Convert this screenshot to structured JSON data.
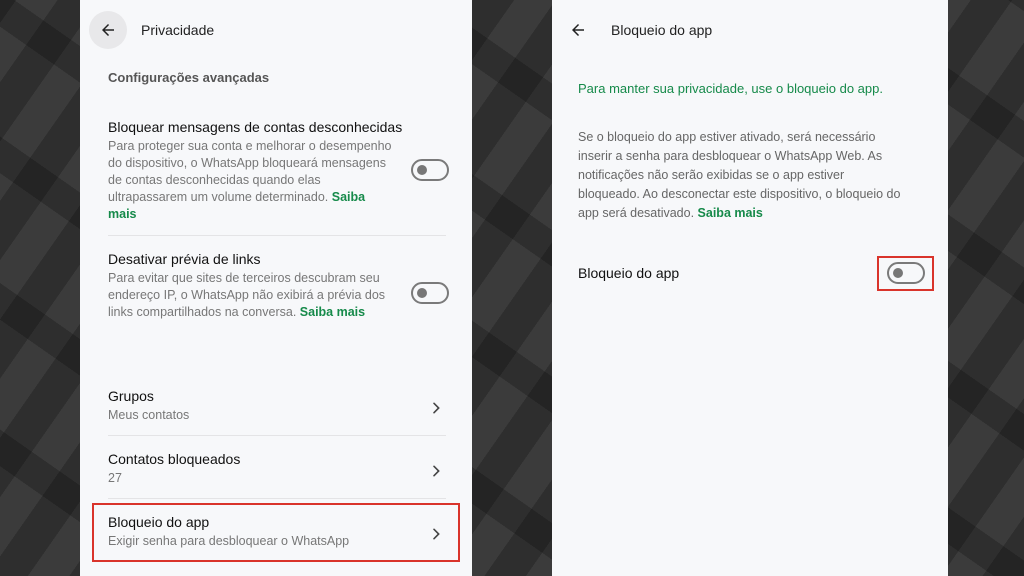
{
  "left": {
    "header_title": "Privacidade",
    "section_title": "Configurações avançadas",
    "block_unknown": {
      "title": "Bloquear mensagens de contas desconhecidas",
      "desc": "Para proteger sua conta e melhorar o desempenho do dispositivo, o WhatsApp bloqueará mensagens de contas desconhecidas quando elas ultrapassarem um volume determinado.",
      "link": "Saiba mais",
      "enabled": false
    },
    "link_preview": {
      "title": "Desativar prévia de links",
      "desc": "Para evitar que sites de terceiros descubram seu endereço IP, o WhatsApp não exibirá a prévia dos links compartilhados na conversa.",
      "link": "Saiba mais",
      "enabled": false
    },
    "rows": [
      {
        "title": "Grupos",
        "subtitle": "Meus contatos"
      },
      {
        "title": "Contatos bloqueados",
        "subtitle": "27"
      },
      {
        "title": "Bloqueio do app",
        "subtitle": "Exigir senha para desbloquear o WhatsApp"
      }
    ]
  },
  "right": {
    "header_title": "Bloqueio do app",
    "intro": "Para manter sua privacidade, use o bloqueio do app.",
    "desc": "Se o bloqueio do app estiver ativado, será necessário inserir a senha para desbloquear o WhatsApp Web. As notificações não serão exibidas se o app estiver bloqueado. Ao desconectar este dispositivo, o bloqueio do app será desativado.",
    "link": "Saiba mais",
    "setting_label": "Bloqueio do app",
    "enabled": false
  },
  "colors": {
    "accent_green": "#168a4a",
    "highlight_red": "#d9342b",
    "panel_bg": "#f7f8fa"
  },
  "icons": {
    "back": "arrow-left-icon",
    "chevron": "chevron-right-icon"
  }
}
